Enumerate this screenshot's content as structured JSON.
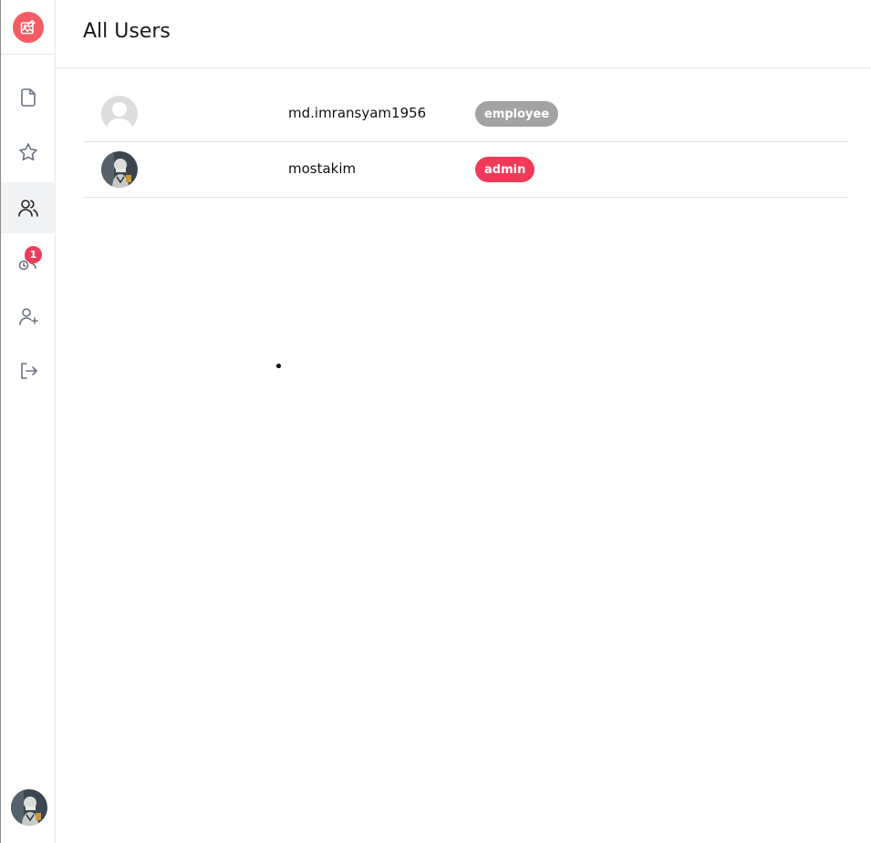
{
  "page": {
    "title": "All Users"
  },
  "sidebar": {
    "items": [
      {
        "name": "documents",
        "icon": "file-icon",
        "active": false
      },
      {
        "name": "favorites",
        "icon": "star-icon",
        "active": false
      },
      {
        "name": "users",
        "icon": "users-icon",
        "active": true
      },
      {
        "name": "pending",
        "icon": "user-clock-icon",
        "active": false,
        "badge": "1"
      },
      {
        "name": "add-user",
        "icon": "user-plus-icon",
        "active": false
      },
      {
        "name": "logout",
        "icon": "logout-icon",
        "active": false
      }
    ]
  },
  "users": [
    {
      "username": "md.imransyam1956",
      "role": "employee",
      "role_color": "#a3a3a3",
      "avatar": "default-avatar"
    },
    {
      "username": "mostakim",
      "role": "admin",
      "role_color": "#ef3b59",
      "avatar": "photo-avatar"
    }
  ],
  "colors": {
    "brand": "#f45b64",
    "badge": "#ef3b59",
    "employee": "#a3a3a3",
    "admin": "#ef3b59"
  }
}
